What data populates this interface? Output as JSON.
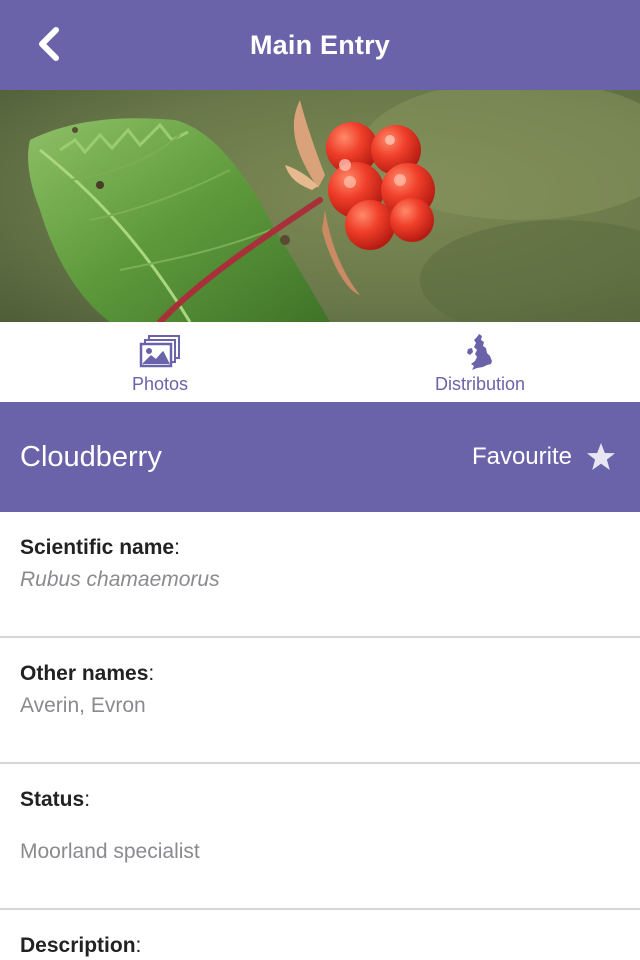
{
  "navbar": {
    "title": "Main Entry",
    "back_icon": "chevron-left-icon",
    "background": "#6b63aa"
  },
  "hero": {
    "subject": "red cloudberry fruit with green leaves"
  },
  "tabs": [
    {
      "label": "Photos",
      "icon": "photos-icon"
    },
    {
      "label": "Distribution",
      "icon": "uk-map-icon"
    }
  ],
  "species": {
    "name": "Cloudberry",
    "favourite_label": "Favourite",
    "favourite_icon": "star-icon",
    "favourited": false
  },
  "details": {
    "scientific": {
      "label": "Scientific name",
      "value": "Rubus chamaemorus"
    },
    "other": {
      "label": "Other names",
      "value": "Averin, Evron"
    },
    "status": {
      "label": "Status",
      "value": "Moorland specialist"
    },
    "description": {
      "label": "Description"
    }
  },
  "colors": {
    "accent": "#6b63aa",
    "label_text": "#222222",
    "value_text": "#8a8a8f",
    "divider": "#d6d6d9"
  }
}
